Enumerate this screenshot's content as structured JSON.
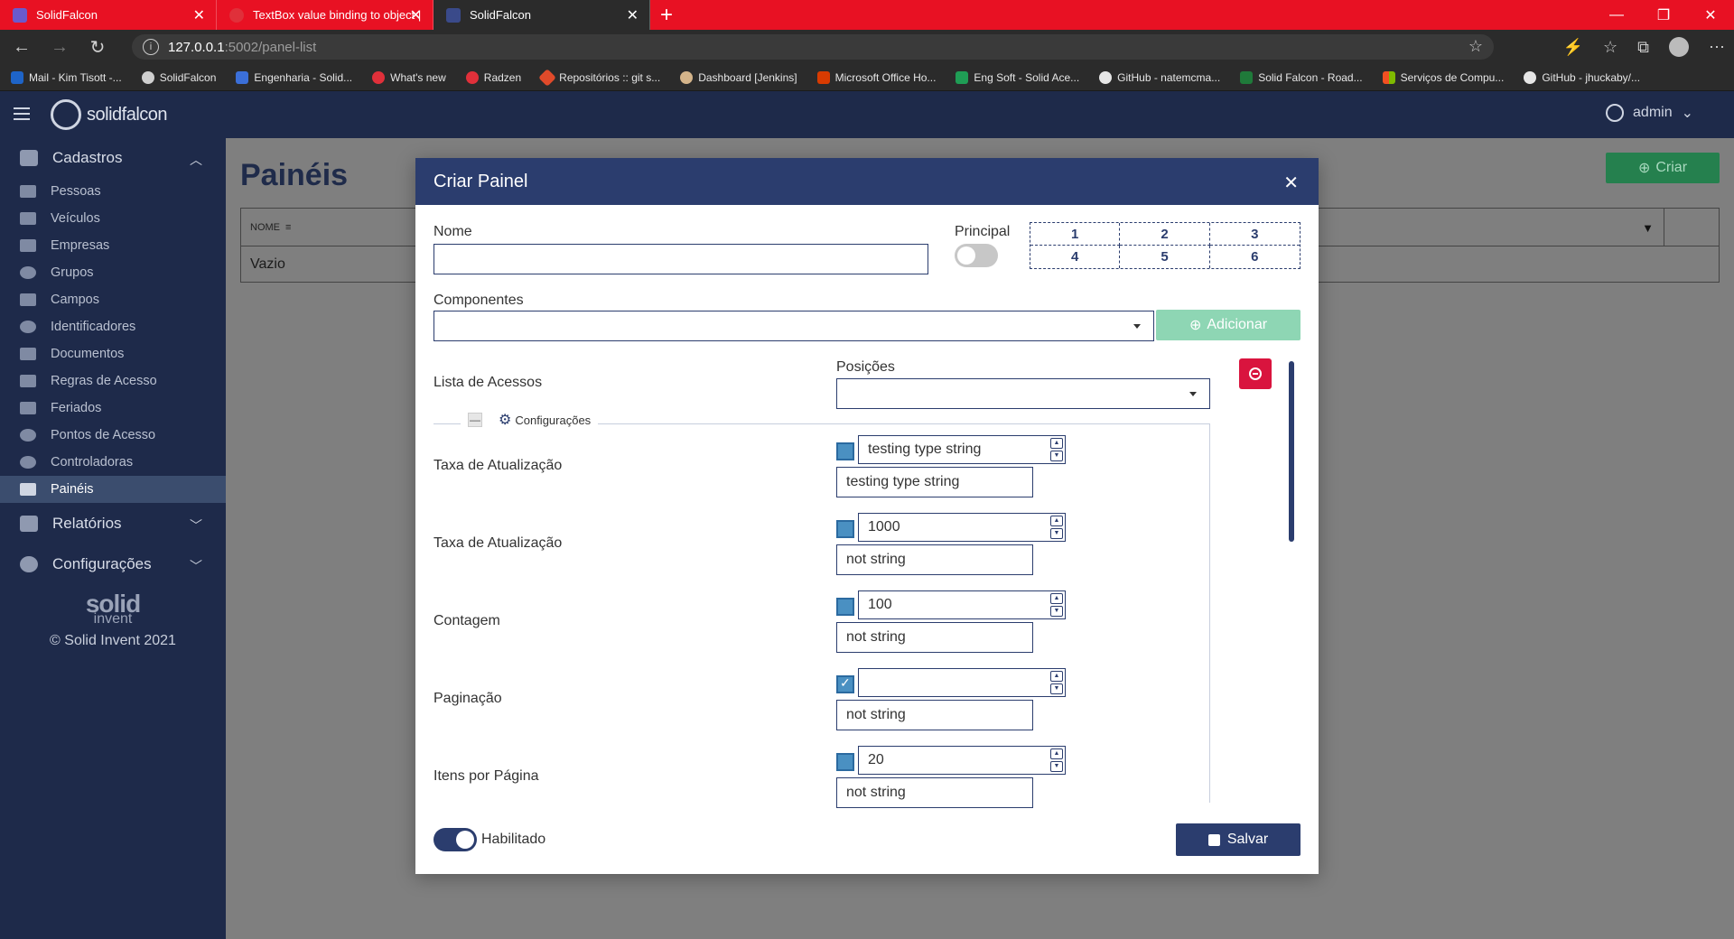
{
  "browser": {
    "tabs": [
      {
        "title": "SolidFalcon",
        "active": false,
        "favcolor": "#6a5acd"
      },
      {
        "title": "TextBox value binding to object |",
        "active": false,
        "favcolor": "#e0303a"
      },
      {
        "title": "SolidFalcon",
        "active": true,
        "favcolor": "#3a4a8a"
      }
    ],
    "url_host": "127.0.0.1",
    "url_path": ":5002/panel-list",
    "bookmarks": [
      {
        "label": "Mail - Kim Tisott -...",
        "color": "#1e64c8"
      },
      {
        "label": "SolidFalcon",
        "color": "#cfcfcf"
      },
      {
        "label": "Engenharia - Solid...",
        "color": "#3b6fd8"
      },
      {
        "label": "What's new",
        "color": "#e0303a"
      },
      {
        "label": "Radzen",
        "color": "#e0303a"
      },
      {
        "label": "Repositórios :: git s...",
        "color": "#e04a2a"
      },
      {
        "label": "Dashboard [Jenkins]",
        "color": "#d4b48a"
      },
      {
        "label": "Microsoft Office Ho...",
        "color": "#d83b01"
      },
      {
        "label": "Eng Soft - Solid Ace...",
        "color": "#1f9d55"
      },
      {
        "label": "GitHub - natemcma...",
        "color": "#e6e6e6"
      },
      {
        "label": "Solid Falcon - Road...",
        "color": "#1f7a3a"
      },
      {
        "label": "Serviços de Compu...",
        "color": "#f25022"
      },
      {
        "label": "GitHub - jhuckaby/...",
        "color": "#e6e6e6"
      }
    ]
  },
  "header": {
    "brand": "solidfalcon",
    "user": "admin"
  },
  "sidebar": {
    "group1": "Cadastros",
    "items": [
      {
        "label": "Pessoas"
      },
      {
        "label": "Veículos"
      },
      {
        "label": "Empresas"
      },
      {
        "label": "Grupos"
      },
      {
        "label": "Campos"
      },
      {
        "label": "Identificadores"
      },
      {
        "label": "Documentos"
      },
      {
        "label": "Regras de Acesso"
      },
      {
        "label": "Feriados"
      },
      {
        "label": "Pontos de Acesso"
      },
      {
        "label": "Controladoras"
      },
      {
        "label": "Painéis"
      }
    ],
    "group2": "Relatórios",
    "group3": "Configurações",
    "footer_brand": "solid",
    "footer_sub": "invent",
    "copyright": "© Solid Invent 2021"
  },
  "main": {
    "title": "Painéis",
    "create_button": "Criar",
    "column_nome": "NOME",
    "empty_text": "Vazio"
  },
  "modal": {
    "title": "Criar Painel",
    "nome_label": "Nome",
    "nome_value": "",
    "principal_label": "Principal",
    "positions_grid": [
      "1",
      "2",
      "3",
      "4",
      "5",
      "6"
    ],
    "componentes_label": "Componentes",
    "componentes_value": "",
    "add_button": "Adicionar",
    "lista_label": "Lista de Acessos",
    "posicoes_label": "Posições",
    "posicoes_value": "",
    "config_legend": "Configurações",
    "rows": [
      {
        "label": "Taxa de Atualização",
        "checked": false,
        "spin": "testing type string",
        "text": "testing type string"
      },
      {
        "label": "Taxa de Atualização",
        "checked": false,
        "spin": "1000",
        "text": "not string"
      },
      {
        "label": "Contagem",
        "checked": false,
        "spin": "100",
        "text": "not string"
      },
      {
        "label": "Paginação",
        "checked": true,
        "spin": "",
        "text": "not string"
      },
      {
        "label": "Itens por Página",
        "checked": false,
        "spin": "20",
        "text": "not string"
      }
    ],
    "enabled_label": "Habilitado",
    "save_button": "Salvar"
  }
}
